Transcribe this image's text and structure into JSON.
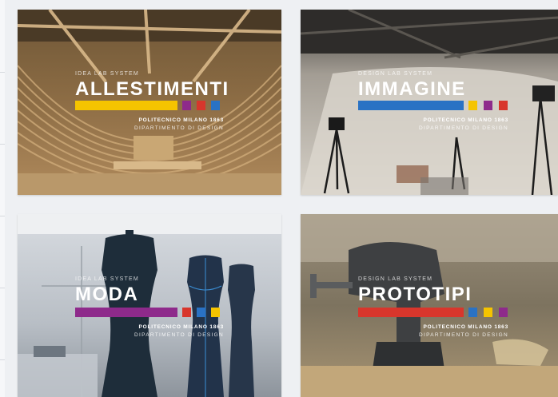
{
  "cards": [
    {
      "kicker": "IDEA LAB SYSTEM",
      "title": "ALLESTIMENTI",
      "org": "POLITECNICO MILANO 1863",
      "dept": "DIPARTIMENTO DI DESIGN",
      "bar_color": "#f5c400",
      "squares": [
        "#8e2a8b",
        "#d8362c",
        "#2a72c4"
      ]
    },
    {
      "kicker": "DESIGN LAB SYSTEM",
      "title": "IMMAGINE",
      "org": "POLITECNICO MILANO 1863",
      "dept": "DIPARTIMENTO DI DESIGN",
      "bar_color": "#2a72c4",
      "squares": [
        "#f5c400",
        "#8e2a8b",
        "#d8362c"
      ]
    },
    {
      "kicker": "IDEA LAB SYSTEM",
      "title": "MODA",
      "org": "POLITECNICO MILANO 1863",
      "dept": "DIPARTIMENTO DI DESIGN",
      "bar_color": "#8e2a8b",
      "squares": [
        "#d8362c",
        "#2a72c4",
        "#f5c400"
      ]
    },
    {
      "kicker": "DESIGN LAB SYSTEM",
      "title": "PROTOTIPI",
      "org": "POLITECNICO MILANO 1863",
      "dept": "DIPARTIMENTO DI DESIGN",
      "bar_color": "#d8362c",
      "squares": [
        "#2a72c4",
        "#f5c400",
        "#8e2a8b"
      ]
    }
  ]
}
